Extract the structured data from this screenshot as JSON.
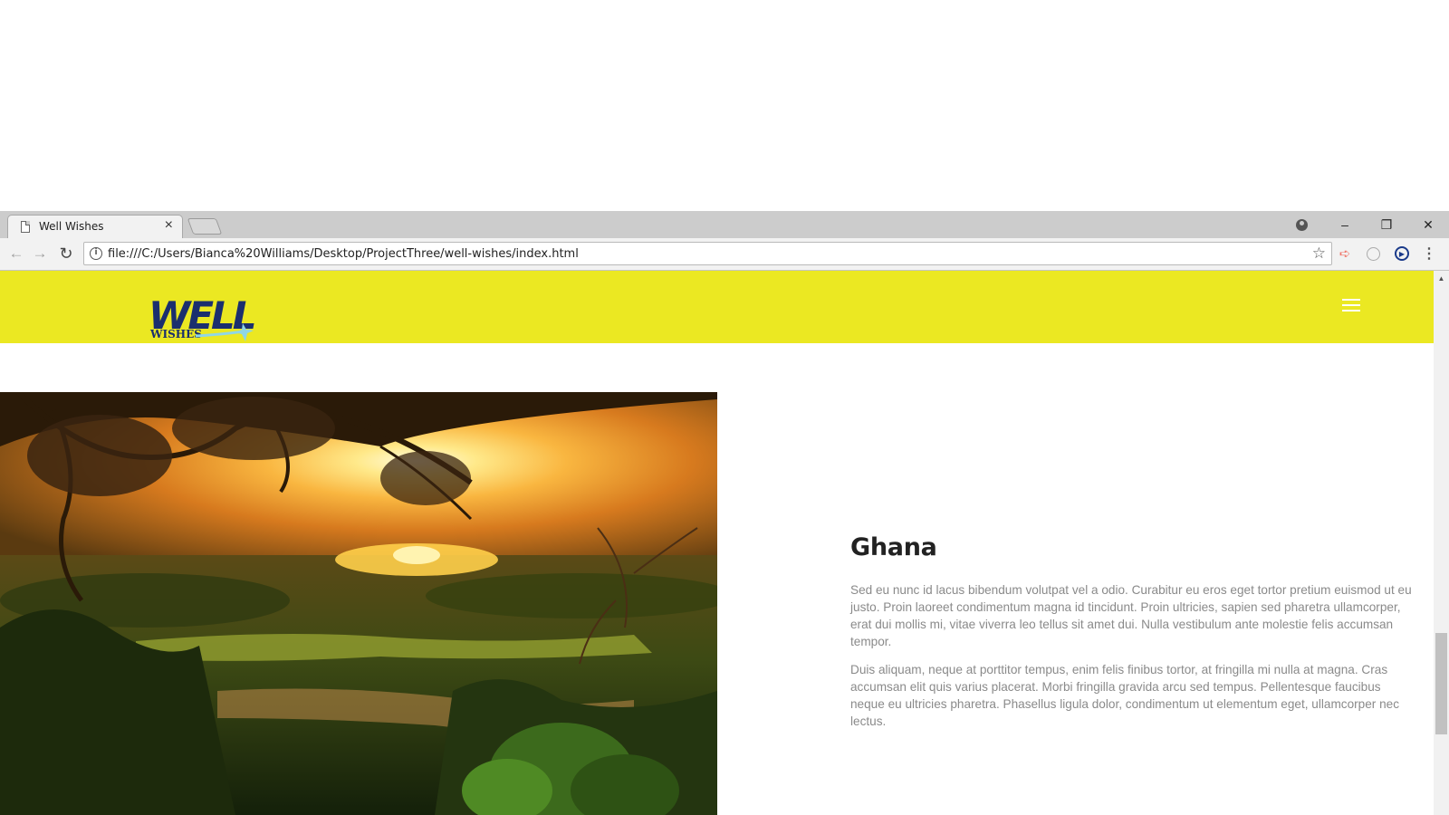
{
  "browser": {
    "tab_title": "Well Wishes",
    "tab_close": "×",
    "url": "file:///C:/Users/Bianca%20Williams/Desktop/ProjectThree/well-wishes/index.html",
    "window_controls": {
      "minimize": "–",
      "restore": "❐",
      "close": "✕"
    },
    "nav": {
      "back": "←",
      "forward": "→",
      "reload": "↻"
    },
    "star": "☆",
    "menu": "⋮"
  },
  "site": {
    "logo_text_main": "WELL",
    "logo_text_sub": "WISHES",
    "header_color": "#ebe822",
    "logo_color": "#1b2f6e",
    "accent_color": "#8fd6e6"
  },
  "section": {
    "title": "Ghana",
    "paragraphs": [
      "Sed eu nunc id lacus bibendum volutpat vel a odio. Curabitur eu eros eget tortor pretium euismod ut eu justo. Proin laoreet condimentum magna id tincidunt. Proin ultricies, sapien sed pharetra ullamcorper, erat dui mollis mi, vitae viverra leo tellus sit amet dui. Nulla vestibulum ante molestie felis accumsan tempor.",
      "Duis aliquam, neque at porttitor tempus, enim felis finibus tortor, at fringilla mi nulla at magna. Cras accumsan elit quis varius placerat. Morbi fringilla gravida arcu sed tempus. Pellentesque faucibus neque eu ultricies pharetra. Phasellus ligula dolor, condimentum ut elementum eget, ullamcorper nec lectus."
    ]
  }
}
